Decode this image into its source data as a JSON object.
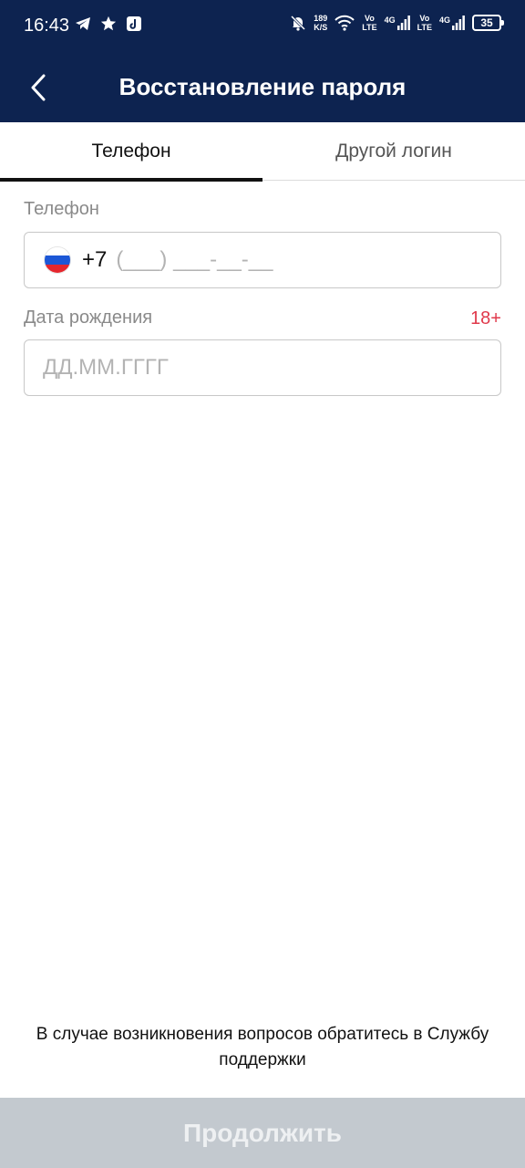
{
  "status_bar": {
    "time": "16:43",
    "speed_value": "189",
    "speed_unit": "K/S",
    "sim1_tech": "Vo\nLTE",
    "sim1_net": "4G",
    "sim2_tech": "Vo\nLTE",
    "sim2_net": "4G",
    "battery": "35",
    "icons": [
      "telegram-icon",
      "star-icon",
      "tiktok-icon",
      "mute-bell-icon",
      "wifi-icon",
      "signal-icon",
      "battery-icon"
    ]
  },
  "header": {
    "title": "Восстановление пароля",
    "back_icon": "chevron-left-icon",
    "background": "#0d2350"
  },
  "tabs": [
    {
      "label": "Телефон",
      "active": true
    },
    {
      "label": "Другой логин",
      "active": false
    }
  ],
  "form": {
    "phone_label": "Телефон",
    "phone_country_code": "+7",
    "phone_mask": "(___) ___-__-__",
    "birthdate_label": "Дата рождения",
    "age_badge": "18+",
    "birthdate_placeholder": "ДД.ММ.ГГГГ"
  },
  "support_text": "В случае возникновения вопросов обратитесь в Службу поддержки",
  "continue_button": "Продолжить",
  "colors": {
    "accent_red": "#e0394b",
    "button_disabled": "#c3c9cf"
  }
}
